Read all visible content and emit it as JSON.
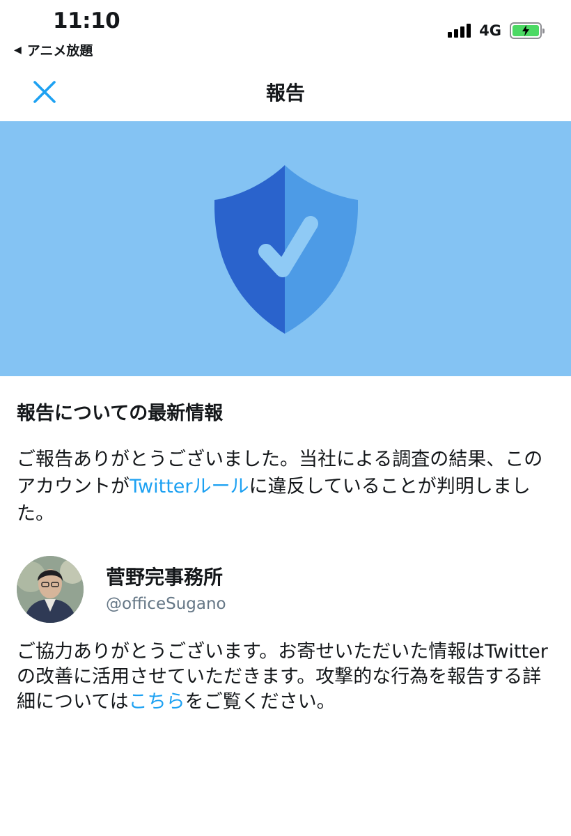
{
  "status_bar": {
    "time": "11:10",
    "back_app": "アニメ放題",
    "back_icon": "back-triangle-icon",
    "network": "4G",
    "signal_icon": "cellular-signal-icon",
    "battery_icon": "battery-charging-icon"
  },
  "header": {
    "title": "報告",
    "close_icon": "close-icon"
  },
  "banner": {
    "icon": "shield-check-icon",
    "colors": {
      "background": "#84c3f3",
      "shield_dark": "#2a63cc",
      "shield_light": "#4d9be6",
      "check": "#8fcaf5"
    }
  },
  "report": {
    "heading": "報告についての最新情報",
    "message_before": "ご報告ありがとうございました。当社による調査の結果、このアカウントが",
    "rules_link": "Twitterルール",
    "message_after": "に違反していることが判明しました。",
    "account": {
      "name": "菅野完事務所",
      "handle": "@officeSugano"
    },
    "thanks_before": "ご協力ありがとうございます。お寄せいただいた情報はTwitterの改善に活用させていただきます。攻撃的な行為を報告する詳細については",
    "here_link": "こちら",
    "thanks_after": "をご覧ください。"
  },
  "colors": {
    "link": "#1da1f2",
    "handle": "#657786"
  }
}
